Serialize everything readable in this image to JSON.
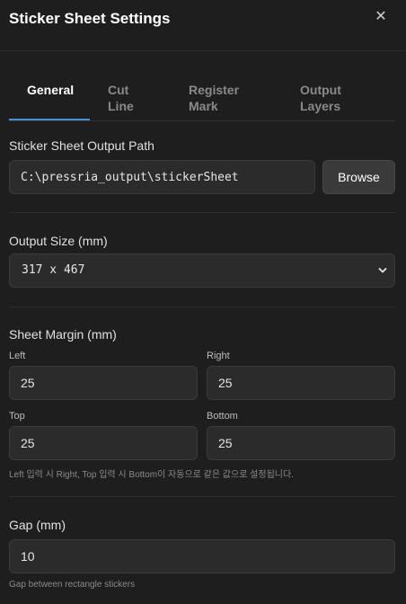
{
  "dialog": {
    "title": "Sticker Sheet Settings",
    "close_icon": "close-icon"
  },
  "tabs": [
    {
      "line1": "General",
      "line2": "",
      "active": true
    },
    {
      "line1": "Cut",
      "line2": "Line",
      "active": false
    },
    {
      "line1": "Register",
      "line2": "Mark",
      "active": false
    },
    {
      "line1": "Output",
      "line2": "Layers",
      "active": false
    }
  ],
  "output_path": {
    "label": "Sticker Sheet Output Path",
    "value": "C:\\pressria_output\\stickerSheet",
    "browse_label": "Browse"
  },
  "output_size": {
    "label": "Output Size (mm)",
    "selected": "317 x 467",
    "icon": "chevron-down-icon"
  },
  "sheet_margin": {
    "label": "Sheet Margin (mm)",
    "left_label": "Left",
    "left_value": "25",
    "right_label": "Right",
    "right_value": "25",
    "top_label": "Top",
    "top_value": "25",
    "bottom_label": "Bottom",
    "bottom_value": "25",
    "hint": "Left 입력 시 Right, Top 입력 시 Bottom이 자동으로 같은 값으로 설정됩니다."
  },
  "gap": {
    "label": "Gap (mm)",
    "value": "10",
    "hint": "Gap between rectangle stickers"
  },
  "colors": {
    "background": "#1e1e1e",
    "accent": "#4a90d9",
    "field": "#2b2b2b"
  }
}
